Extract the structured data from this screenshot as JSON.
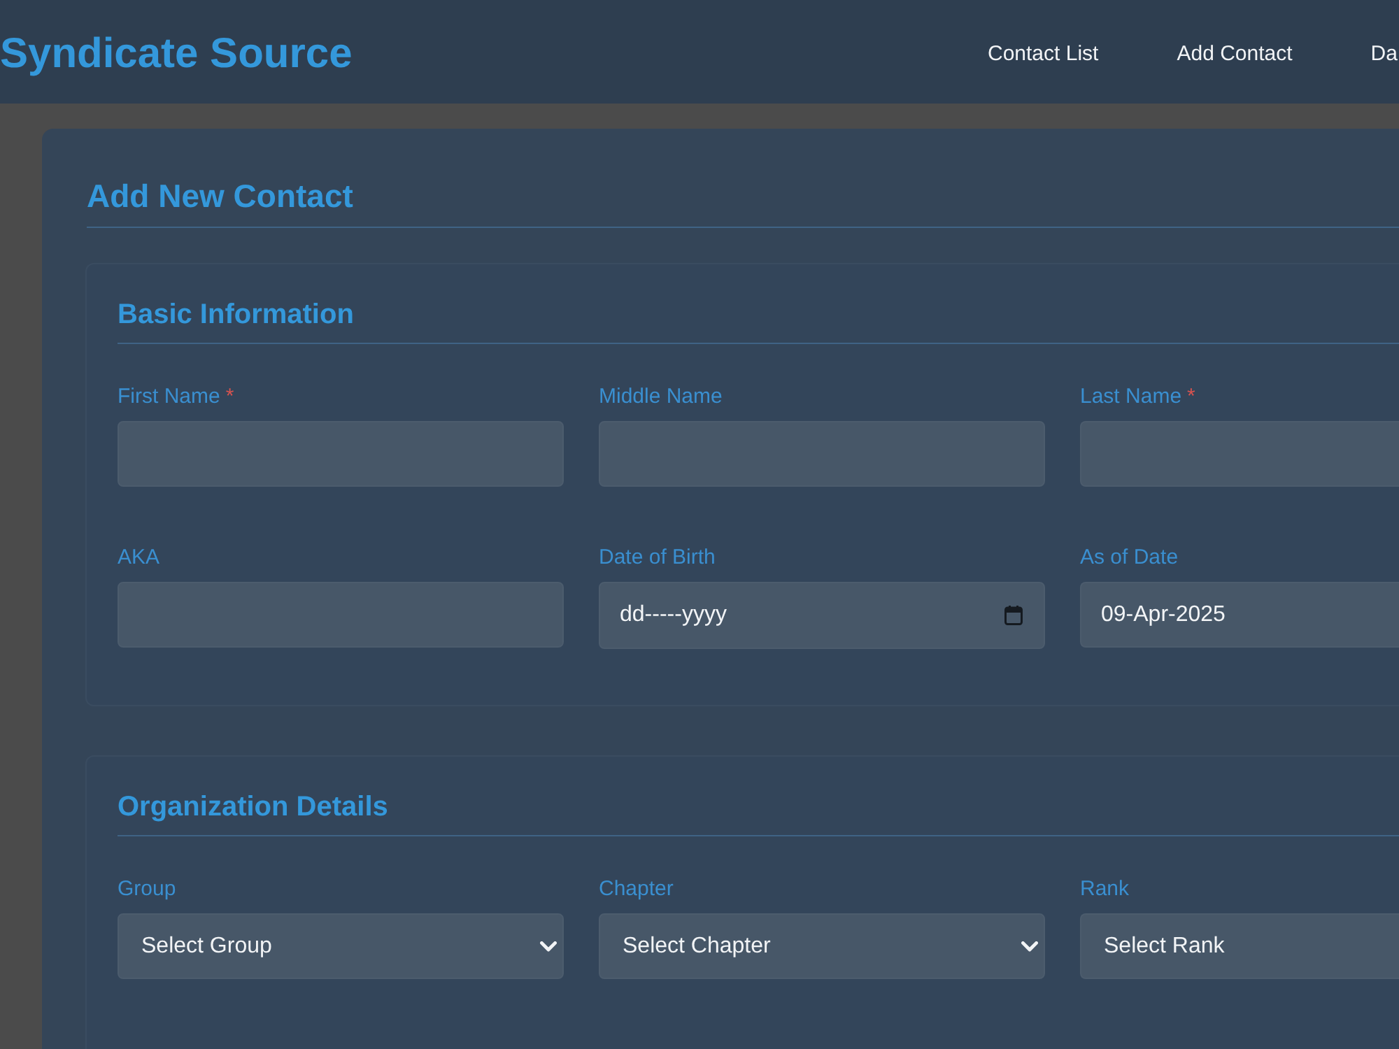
{
  "header": {
    "logo": "Syndicate Source",
    "nav": [
      "Contact List",
      "Add Contact",
      "Da"
    ]
  },
  "page_title": "Add New Contact",
  "sections": [
    {
      "title": "Basic Information",
      "fields": [
        {
          "kind": "text",
          "label": "First Name",
          "required_mark": "*"
        },
        {
          "kind": "text",
          "label": "Middle Name"
        },
        {
          "kind": "text",
          "label": "Last Name",
          "required_mark": "*"
        },
        {
          "kind": "text",
          "label": "AKA"
        },
        {
          "kind": "date",
          "label": "Date of Birth",
          "placeholder": "dd-----yyyy"
        },
        {
          "kind": "text",
          "label": "As of Date",
          "value": "09-Apr-2025"
        }
      ]
    },
    {
      "title": "Organization Details",
      "fields": [
        {
          "kind": "select",
          "label": "Group",
          "value": "Select Group"
        },
        {
          "kind": "select",
          "label": "Chapter",
          "value": "Select Chapter"
        },
        {
          "kind": "select",
          "label": "Rank",
          "value": "Select Rank"
        }
      ]
    }
  ]
}
